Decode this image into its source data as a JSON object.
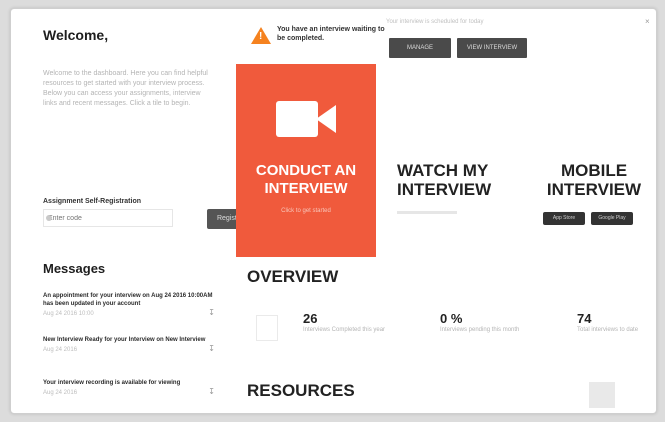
{
  "left": {
    "welcome_title": "Welcome,",
    "welcome_text": "Welcome to the dashboard. Here you can find helpful resources to get started with your interview process. Below you can access your assignments, interview links and recent messages. Click a tile to begin.",
    "assignment_title": "Assignment Self-Registration",
    "assignment_placeholder": "Enter code",
    "assignment_button": "Register",
    "messages_title": "Messages",
    "messages": [
      {
        "text": "An appointment for your interview on Aug 24 2016 10:00AM has been updated in your account",
        "meta": "Aug 24 2016 10:00"
      },
      {
        "text": "New Interview Ready for your Interview on New Interview",
        "meta": "Aug 24 2016"
      },
      {
        "text": "Your interview recording is available for viewing",
        "meta": "Aug 24 2016"
      }
    ]
  },
  "notification": {
    "text": "You have an interview waiting to be completed."
  },
  "top": {
    "info": "Your interview is scheduled for today",
    "button_1": "MANAGE",
    "button_2": "VIEW INTERVIEW"
  },
  "tiles": {
    "conduct_title": "CONDUCT AN INTERVIEW",
    "conduct_sub": "Click to get started",
    "watch_title": "WATCH MY INTERVIEW",
    "mobile_title": "MOBILE INTERVIEW",
    "store_1": "App Store",
    "store_2": "Google Play"
  },
  "overview": {
    "title": "OVERVIEW",
    "stats": [
      {
        "value": "26",
        "label": "Interviews Completed this year"
      },
      {
        "value": "0 %",
        "label": "Interviews pending this month"
      },
      {
        "value": "74",
        "label": "Total interviews to date"
      }
    ]
  },
  "resources": {
    "title": "RESOURCES"
  },
  "colors": {
    "accent": "#f05a3c",
    "warning": "#f5821f",
    "dark_button": "#4a4a4a"
  }
}
